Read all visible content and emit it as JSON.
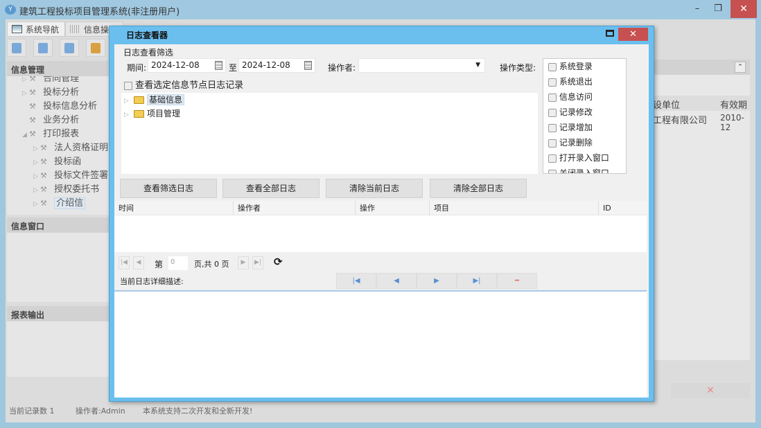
{
  "app": {
    "title": "建筑工程投标项目管理系统(非注册用户)",
    "logo": "Y"
  },
  "tabs": [
    {
      "label": "系统导航"
    },
    {
      "label": "信息操作"
    }
  ],
  "left": {
    "panel1": "信息管理",
    "tree": [
      {
        "label": "合同管理",
        "level": 1,
        "arrow": "▷"
      },
      {
        "label": "投标分析",
        "level": 1,
        "arrow": "▷"
      },
      {
        "label": "投标信息分析",
        "level": 1,
        "arrow": ""
      },
      {
        "label": "业务分析",
        "level": 1,
        "arrow": ""
      },
      {
        "label": "打印报表",
        "level": 1,
        "arrow": "◢"
      },
      {
        "label": "法人资格证明",
        "level": 2,
        "arrow": "▷"
      },
      {
        "label": "投标函",
        "level": 2,
        "arrow": "▷"
      },
      {
        "label": "投标文件签署",
        "level": 2,
        "arrow": "▷"
      },
      {
        "label": "授权委托书",
        "level": 2,
        "arrow": "▷"
      },
      {
        "label": "介绍信",
        "level": 2,
        "arrow": "▷"
      }
    ],
    "panel2": "信息窗口",
    "panel3": "报表输出"
  },
  "right": {
    "col1": "设单位",
    "col2": "有效期",
    "cell1": "工程有限公司",
    "cell2": "2010-12"
  },
  "status": {
    "records": "当前记录数 1",
    "operator": "操作者:Admin",
    "note": "本系统支持二次开发和全新开发!"
  },
  "dialog": {
    "title": "日志查看器",
    "filter_label": "日志查看筛选",
    "period_label": "期间:",
    "date_from": "2024-12-08",
    "to_label": "至",
    "date_to": "2024-12-08",
    "operator_label": "操作者:",
    "operator_value": "",
    "optype_label": "操作类型:",
    "optypes": [
      "系统登录",
      "系统退出",
      "信息访问",
      "记录修改",
      "记录增加",
      "记录删除",
      "打开录入窗口",
      "关闭录入窗口"
    ],
    "node_check_label": "查看选定信息节点日志记录",
    "tree": [
      "基础信息",
      "项目管理"
    ],
    "buttons": [
      "查看筛选日志",
      "查看全部日志",
      "清除当前日志",
      "清除全部日志"
    ],
    "columns": [
      "时间",
      "操作者",
      "操作",
      "项目",
      "ID"
    ],
    "pager": {
      "prefix": "第",
      "page": "0",
      "suffix": "页,共 0 页"
    },
    "detail_label": "当前日志详细描述:"
  }
}
